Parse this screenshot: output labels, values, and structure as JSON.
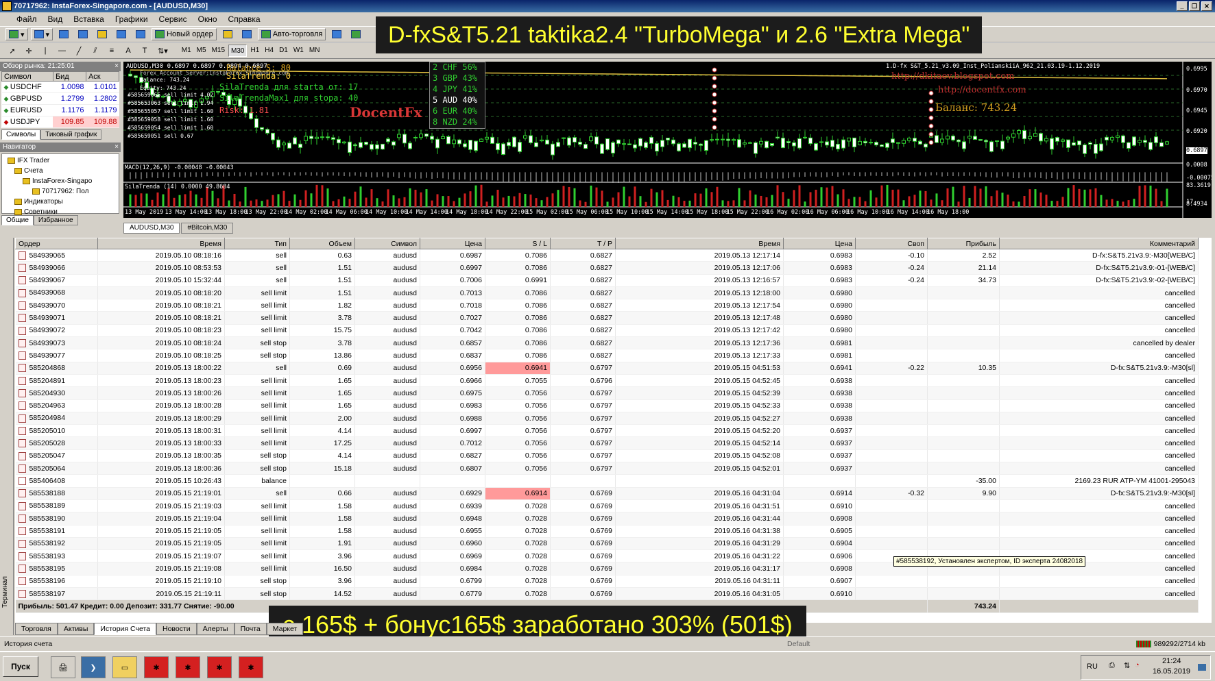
{
  "window": {
    "title": "70717962: InstaForex-Singapore.com - [AUDUSD,M30]"
  },
  "menu": [
    "Файл",
    "Вид",
    "Вставка",
    "Графики",
    "Сервис",
    "Окно",
    "Справка"
  ],
  "toolbar": {
    "new_order": "Новый ордер",
    "auto_trading": "Авто-торговля",
    "timeframes": [
      "M1",
      "M5",
      "M15",
      "M30",
      "H1",
      "H4",
      "D1",
      "W1",
      "MN"
    ],
    "active_tf": "M30"
  },
  "banner_top": "D-fxS&T5.21 taktika2.4 \"TurboMega\" и 2.6 \"Extra Mega\"",
  "banner_bottom": "с 165$ + бонус165$ заработано 303% (501$)",
  "market_watch": {
    "title": "Обзор рынка: 21:25:01",
    "headers": [
      "Символ",
      "Бид",
      "Аск"
    ],
    "rows": [
      {
        "sym": "USDCHF",
        "bid": "1.0098",
        "ask": "1.0101",
        "dir": "up"
      },
      {
        "sym": "GBPUSD",
        "bid": "1.2799",
        "ask": "1.2802",
        "dir": "up"
      },
      {
        "sym": "EURUSD",
        "bid": "1.1176",
        "ask": "1.1179",
        "dir": "up"
      },
      {
        "sym": "USDJPY",
        "bid": "109.85",
        "ask": "109.88",
        "dir": "dn"
      }
    ],
    "tabs": [
      "Символы",
      "Тиковый график"
    ]
  },
  "navigator": {
    "title": "Навигатор",
    "items": [
      "IFX Trader",
      "Счета",
      "InstaForex-Singapo",
      "70717962: Пол",
      "Индикаторы",
      "Советники"
    ],
    "tabs": [
      "Общие",
      "Избранное"
    ]
  },
  "chart": {
    "header": "AUDUSD,M30  0.6897 0.6897 0.6894 0.6897",
    "overlay_lines": [
      "Balance S: 80",
      "Forex Account Server:InstaForex-Singapore.com",
      "SilaTrenda: 0",
      "SilaTrenda для starta от: 17",
      "SilaTrendaMax1 для stopa: 40",
      "Risk: 1.81",
      "Balance: 743.24",
      "Equity: 743.24"
    ],
    "currency_box": [
      "2 CHF 56%",
      "3 GBP 43%",
      "4 JPY 41%",
      "5 AUD 40%",
      "6 EUR 40%",
      "8 NZD 24%"
    ],
    "watermark": "DocentFx",
    "ea_label": "1.D-fx S&T_5.21_v3.09_Inst_PolianskiiA_962_21.03.19-1.12.2019",
    "url1": "http://dkitaev.blogspot.com",
    "url2": "http://docentfx.com",
    "balance": "Баланс: 743.24",
    "price_axis": [
      "0.6995",
      "0.6970",
      "0.6945",
      "0.6920",
      "0.6897",
      "0.0008",
      "-0.00075",
      "83.3619",
      "17",
      "8.4934"
    ],
    "price_ticks": [
      "0.6995",
      "0.6970",
      "0.6945",
      "0.6920"
    ],
    "price_mark": "0.6897",
    "macd_ticks": [
      "0.0008",
      "-0.00075"
    ],
    "sila_ticks": [
      "83.3619",
      "17",
      "8.4934"
    ],
    "order_labels": [
      "#585659065 sell limit 4.02",
      "#585653063 sell limit 1.94",
      "#585655057 sell limit 1.60",
      "#585659058 sell limit 1.60",
      "#585659054 sell limit 1.60",
      "#585659051 sell 0.67"
    ],
    "macd_label": "MACD(12,26,9) -0.00048 -0.00043",
    "sila_label": "SilaTrenda (14) 0.0000 49.8684",
    "time_axis": [
      "13 May 2019",
      "13 May 14:00",
      "13 May 18:00",
      "13 May 22:00",
      "14 May 02:00",
      "14 May 06:00",
      "14 May 10:00",
      "14 May 14:00",
      "14 May 18:00",
      "14 May 22:00",
      "15 May 02:00",
      "15 May 06:00",
      "15 May 10:00",
      "15 May 14:00",
      "15 May 18:00",
      "15 May 22:00",
      "16 May 02:00",
      "16 May 06:00",
      "16 May 10:00",
      "16 May 14:00",
      "16 May 18:00"
    ]
  },
  "chart_tabs": [
    "AUDUSD,M30",
    "#Bitcoin,M30"
  ],
  "history": {
    "headers": [
      "Ордер",
      "Время",
      "Тип",
      "Объем",
      "Символ",
      "Цена",
      "S / L",
      "T / P",
      "Время",
      "Цена",
      "Своп",
      "Прибыль",
      "Комментарий"
    ],
    "rows": [
      [
        "584939065",
        "2019.05.10 08:18:16",
        "sell",
        "0.63",
        "audusd",
        "0.6987",
        "0.7086",
        "0.6827",
        "2019.05.13 12:17:14",
        "0.6983",
        "-0.10",
        "2.52",
        "D-fx:S&T5.21v3.9:-M30[WEB/C]"
      ],
      [
        "584939066",
        "2019.05.10 08:53:53",
        "sell",
        "1.51",
        "audusd",
        "0.6997",
        "0.7086",
        "0.6827",
        "2019.05.13 12:17:06",
        "0.6983",
        "-0.24",
        "21.14",
        "D-fx:S&T5.21v3.9:-01-[WEB/C]"
      ],
      [
        "584939067",
        "2019.05.10 15:32:44",
        "sell",
        "1.51",
        "audusd",
        "0.7006",
        "0.6991",
        "0.6827",
        "2019.05.13 12:16:57",
        "0.6983",
        "-0.24",
        "34.73",
        "D-fx:S&T5.21v3.9:-02-[WEB/C]"
      ],
      [
        "584939068",
        "2019.05.10 08:18:20",
        "sell limit",
        "1.51",
        "audusd",
        "0.7013",
        "0.7086",
        "0.6827",
        "2019.05.13 12:18:00",
        "0.6980",
        "",
        "",
        "cancelled"
      ],
      [
        "584939070",
        "2019.05.10 08:18:21",
        "sell limit",
        "1.82",
        "audusd",
        "0.7018",
        "0.7086",
        "0.6827",
        "2019.05.13 12:17:54",
        "0.6980",
        "",
        "",
        "cancelled"
      ],
      [
        "584939071",
        "2019.05.10 08:18:21",
        "sell limit",
        "3.78",
        "audusd",
        "0.7027",
        "0.7086",
        "0.6827",
        "2019.05.13 12:17:48",
        "0.6980",
        "",
        "",
        "cancelled"
      ],
      [
        "584939072",
        "2019.05.10 08:18:23",
        "sell limit",
        "15.75",
        "audusd",
        "0.7042",
        "0.7086",
        "0.6827",
        "2019.05.13 12:17:42",
        "0.6980",
        "",
        "",
        "cancelled"
      ],
      [
        "584939073",
        "2019.05.10 08:18:24",
        "sell stop",
        "3.78",
        "audusd",
        "0.6857",
        "0.7086",
        "0.6827",
        "2019.05.13 12:17:36",
        "0.6981",
        "",
        "",
        "cancelled by dealer"
      ],
      [
        "584939077",
        "2019.05.10 08:18:25",
        "sell stop",
        "13.86",
        "audusd",
        "0.6837",
        "0.7086",
        "0.6827",
        "2019.05.13 12:17:33",
        "0.6981",
        "",
        "",
        "cancelled"
      ],
      [
        "585204868",
        "2019.05.13 18:00:22",
        "sell",
        "0.69",
        "audusd",
        "0.6956",
        "0.6941",
        "0.6797",
        "2019.05.15 04:51:53",
        "0.6941",
        "-0.22",
        "10.35",
        "D-fx:S&T5.21v3.9:-M30[sl]"
      ],
      [
        "585204891",
        "2019.05.13 18:00:23",
        "sell limit",
        "1.65",
        "audusd",
        "0.6966",
        "0.7055",
        "0.6796",
        "2019.05.15 04:52:45",
        "0.6938",
        "",
        "",
        "cancelled"
      ],
      [
        "585204930",
        "2019.05.13 18:00:26",
        "sell limit",
        "1.65",
        "audusd",
        "0.6975",
        "0.7056",
        "0.6797",
        "2019.05.15 04:52:39",
        "0.6938",
        "",
        "",
        "cancelled"
      ],
      [
        "585204963",
        "2019.05.13 18:00:28",
        "sell limit",
        "1.65",
        "audusd",
        "0.6983",
        "0.7056",
        "0.6797",
        "2019.05.15 04:52:33",
        "0.6938",
        "",
        "",
        "cancelled"
      ],
      [
        "585204984",
        "2019.05.13 18:00:29",
        "sell limit",
        "2.00",
        "audusd",
        "0.6988",
        "0.7056",
        "0.6797",
        "2019.05.15 04:52:27",
        "0.6938",
        "",
        "",
        "cancelled"
      ],
      [
        "585205010",
        "2019.05.13 18:00:31",
        "sell limit",
        "4.14",
        "audusd",
        "0.6997",
        "0.7056",
        "0.6797",
        "2019.05.15 04:52:20",
        "0.6937",
        "",
        "",
        "cancelled"
      ],
      [
        "585205028",
        "2019.05.13 18:00:33",
        "sell limit",
        "17.25",
        "audusd",
        "0.7012",
        "0.7056",
        "0.6797",
        "2019.05.15 04:52:14",
        "0.6937",
        "",
        "",
        "cancelled"
      ],
      [
        "585205047",
        "2019.05.13 18:00:35",
        "sell stop",
        "4.14",
        "audusd",
        "0.6827",
        "0.7056",
        "0.6797",
        "2019.05.15 04:52:08",
        "0.6937",
        "",
        "",
        "cancelled"
      ],
      [
        "585205064",
        "2019.05.13 18:00:36",
        "sell stop",
        "15.18",
        "audusd",
        "0.6807",
        "0.7056",
        "0.6797",
        "2019.05.15 04:52:01",
        "0.6937",
        "",
        "",
        "cancelled"
      ],
      [
        "585406408",
        "2019.05.15 10:26:43",
        "balance",
        "",
        "",
        "",
        "",
        "",
        "",
        "",
        "",
        "-35.00",
        "2169.23 RUR ATP-YM 41001-295043"
      ],
      [
        "585538188",
        "2019.05.15 21:19:01",
        "sell",
        "0.66",
        "audusd",
        "0.6929",
        "0.6914",
        "0.6769",
        "2019.05.16 04:31:04",
        "0.6914",
        "-0.32",
        "9.90",
        "D-fx:S&T5.21v3.9:-M30[sl]"
      ],
      [
        "585538189",
        "2019.05.15 21:19:03",
        "sell limit",
        "1.58",
        "audusd",
        "0.6939",
        "0.7028",
        "0.6769",
        "2019.05.16 04:31:51",
        "0.6910",
        "",
        "",
        "cancelled"
      ],
      [
        "585538190",
        "2019.05.15 21:19:04",
        "sell limit",
        "1.58",
        "audusd",
        "0.6948",
        "0.7028",
        "0.6769",
        "2019.05.16 04:31:44",
        "0.6908",
        "",
        "",
        "cancelled"
      ],
      [
        "585538191",
        "2019.05.15 21:19:05",
        "sell limit",
        "1.58",
        "audusd",
        "0.6955",
        "0.7028",
        "0.6769",
        "2019.05.16 04:31:38",
        "0.6905",
        "",
        "",
        "cancelled"
      ],
      [
        "585538192",
        "2019.05.15 21:19:05",
        "sell limit",
        "1.91",
        "audusd",
        "0.6960",
        "0.7028",
        "0.6769",
        "2019.05.16 04:31:29",
        "0.6904",
        "",
        "",
        "cancelled"
      ],
      [
        "585538193",
        "2019.05.15 21:19:07",
        "sell limit",
        "3.96",
        "audusd",
        "0.6969",
        "0.7028",
        "0.6769",
        "2019.05.16 04:31:22",
        "0.6906",
        "",
        "",
        "cancelled"
      ],
      [
        "585538195",
        "2019.05.15 21:19:08",
        "sell limit",
        "16.50",
        "audusd",
        "0.6984",
        "0.7028",
        "0.6769",
        "2019.05.16 04:31:17",
        "0.6908",
        "",
        "",
        "cancelled"
      ],
      [
        "585538196",
        "2019.05.15 21:19:10",
        "sell stop",
        "3.96",
        "audusd",
        "0.6799",
        "0.7028",
        "0.6769",
        "2019.05.16 04:31:11",
        "0.6907",
        "",
        "",
        "cancelled"
      ],
      [
        "585538197",
        "2019.05.15 21:19:11",
        "sell stop",
        "14.52",
        "audusd",
        "0.6779",
        "0.7028",
        "0.6769",
        "2019.05.16 04:31:05",
        "0.6910",
        "",
        "",
        "cancelled"
      ]
    ],
    "red_sl_rows": [
      9,
      19
    ],
    "summary": "Прибыль: 501.47  Кредит: 0.00  Депозит: 331.77  Снятие: -90.00",
    "summary_total": "743.24"
  },
  "tooltip": "#585538192, Установлен экспертом, ID эксперта 24082018",
  "terminal_side": "Терминал",
  "terminal_tabs": [
    "Торговля",
    "Активы",
    "История Счета",
    "Новости",
    "Алерты",
    "Почта",
    "Маркет"
  ],
  "active_terminal_tab": "История Счета",
  "status": {
    "left": "История счета",
    "default": "Default",
    "conn": "989292/2714 kb"
  },
  "taskbar": {
    "start": "Пуск",
    "lang": "RU",
    "time": "21:24",
    "date": "16.05.2019"
  }
}
